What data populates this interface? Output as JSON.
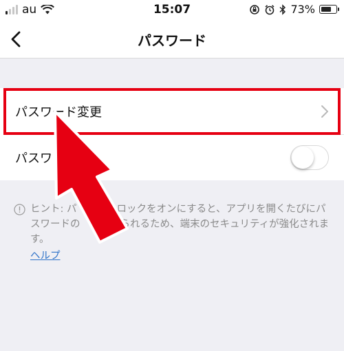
{
  "status_bar": {
    "carrier": "au",
    "time": "15:07",
    "battery": "73%",
    "battery_level": 0.73
  },
  "nav": {
    "title": "パスワード"
  },
  "list": {
    "change_password": "パスワード変更",
    "password_lock": "パスワ",
    "password_lock_on": false
  },
  "hint": {
    "text": "ヒント: パ　　　　ロックをオンにすると、アプリを開くたびにパスワードの　　求められるため、端末のセキュリティが強化されます。",
    "help_link": "ヘルプ"
  },
  "colors": {
    "highlight": "#e60012",
    "link": "#2f73c9"
  }
}
